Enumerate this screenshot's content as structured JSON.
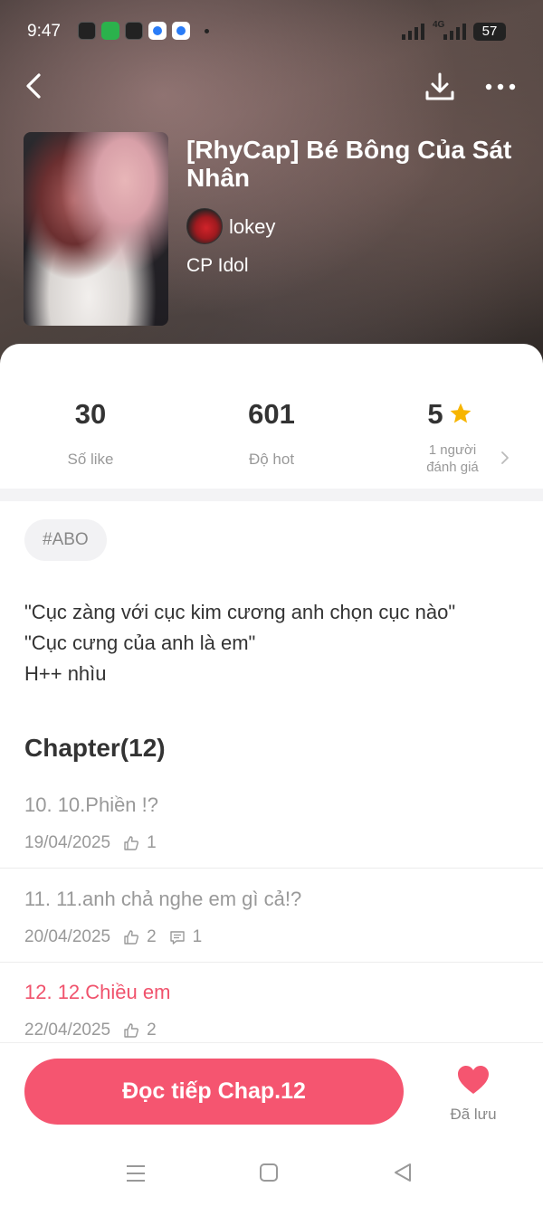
{
  "status_bar": {
    "time": "9:47",
    "network": "4G",
    "battery": "57"
  },
  "header": {
    "icons": [
      "back-icon",
      "download-icon",
      "more-icon"
    ]
  },
  "story": {
    "title": "[RhyCap] Bé Bông Của Sát Nhân",
    "author": "lokey",
    "category": "CP Idol"
  },
  "stats": {
    "likes_value": "30",
    "likes_label": "Số like",
    "hot_value": "601",
    "hot_label": "Độ hot",
    "rating_value": "5",
    "rating_label_line1": "1 người",
    "rating_label_line2": "đánh giá"
  },
  "tag": "#ABO",
  "description": [
    "\"Cục zàng với cục kim cương anh chọn cục nào\"",
    "\"Cục cưng của anh là em\"",
    "H++ nhìu"
  ],
  "chapters": {
    "heading": "Chapter(12)",
    "items": [
      {
        "title": "10. 10.Phiền !?",
        "date": "19/04/2025",
        "likes": "1",
        "comments": null
      },
      {
        "title": "11. 11.anh chả nghe em gì cả!?",
        "date": "20/04/2025",
        "likes": "2",
        "comments": "1"
      },
      {
        "title": "12. 12.Chiều em",
        "date": "22/04/2025",
        "likes": "2",
        "comments": null
      }
    ]
  },
  "actions": {
    "read_button": "Đọc tiếp Chap.12",
    "saved_label": "Đã lưu"
  },
  "colors": {
    "accent": "#f55570",
    "star": "#f7b500",
    "text_primary": "#333333",
    "text_secondary": "#999999"
  }
}
